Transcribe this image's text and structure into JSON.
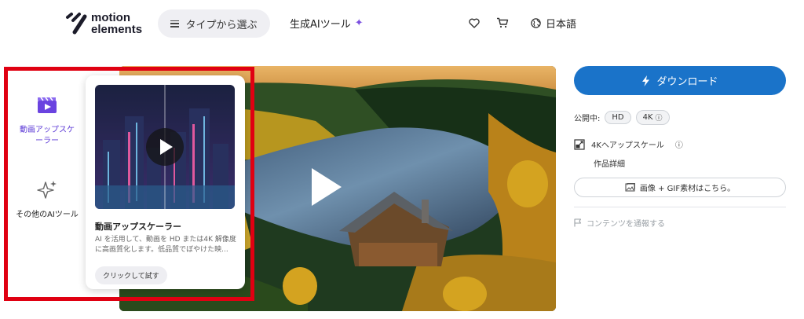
{
  "header": {
    "logo_line1": "motion",
    "logo_line2": "elements",
    "type_button_label": "タイプから選ぶ",
    "gen_ai_label": "生成AIツール",
    "language_label": "日本語",
    "icons": [
      "menu-icon",
      "sparkle-icon",
      "heart-icon",
      "cart-icon",
      "globe-icon"
    ]
  },
  "ai_tools": {
    "items": [
      {
        "label": "動画アップスケーラー",
        "icon": "clapperboard-icon",
        "active": true
      },
      {
        "label": "その他のAIツール",
        "icon": "sparkles-icon",
        "active": false
      }
    ],
    "card": {
      "title": "動画アップスケーラー",
      "description": "AI を活用して、動画を HD または4K 解像度に高画質化します。低品質でぼやけた映...",
      "button_label": "クリックして試す"
    }
  },
  "sidebar": {
    "download_label": "ダウンロード",
    "published_label": "公開中:",
    "formats": [
      "HD",
      "4K"
    ],
    "upscale_label": "4Kへアップスケール",
    "details_label": "作品詳細",
    "gif_label": "画像 + GIF素材はこちら。",
    "report_label": "コンテンツを通報する"
  },
  "colors": {
    "accent_purple": "#5b38d6",
    "download_blue": "#1a73c9",
    "highlight_red": "#e00012"
  }
}
